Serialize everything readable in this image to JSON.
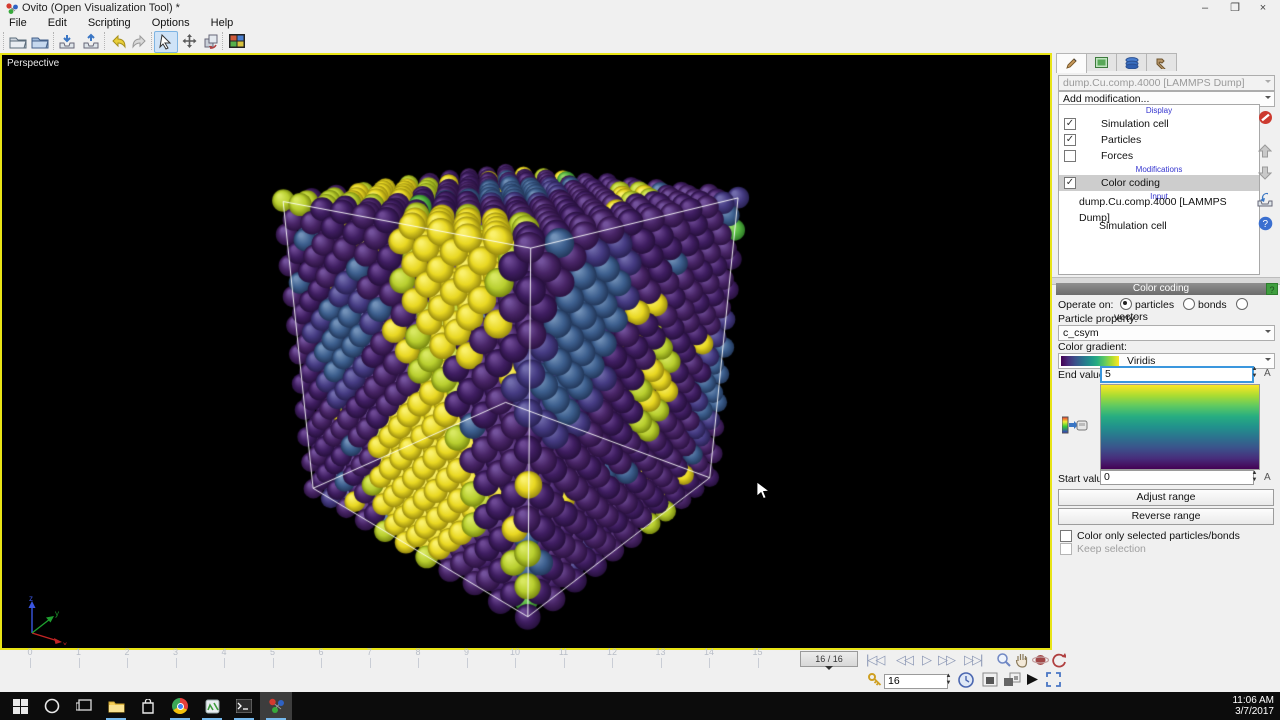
{
  "window": {
    "title": "Ovito (Open Visualization Tool) *",
    "minimize": "–",
    "restore": "❐",
    "close": "×"
  },
  "menubar": [
    "File",
    "Edit",
    "Scripting",
    "Options",
    "Help"
  ],
  "toolbar": [
    "open-file",
    "open-remote-file",
    "import-file",
    "export-file",
    "undo",
    "redo",
    "selection-mode",
    "move-mode",
    "rotate-mode",
    "render-settings"
  ],
  "viewport": {
    "label": "Perspective",
    "axis_x": "x",
    "axis_y": "y",
    "axis_z": "z"
  },
  "scene": {
    "cells": 10,
    "box_color": "rgba(255,255,255,0.9)",
    "palette": {
      "yellow": [
        "#faf06a",
        "#e9d822",
        "#97890e"
      ],
      "lime": [
        "#d8e860",
        "#b9cf2f",
        "#76860f"
      ],
      "green": [
        "#93d765",
        "#57b944",
        "#2e7a26"
      ],
      "purple": [
        "#6c4893",
        "#3f1e61",
        "#26103c"
      ],
      "purple2": [
        "#73529c",
        "#482566",
        "#2b1240"
      ],
      "slate": [
        "#716cac",
        "#453b82",
        "#282152"
      ],
      "blue": [
        "#7291b8",
        "#3d5f8e",
        "#22375a"
      ]
    }
  },
  "command_panel": {
    "tabs": [
      "modify",
      "render",
      "overlays",
      "utilities"
    ],
    "source_selector": "dump.Cu.comp.4000 [LAMMPS Dump]",
    "add_modification": "Add modification...",
    "pipeline": [
      {
        "type": "header",
        "label": "Display"
      },
      {
        "type": "item",
        "label": "Simulation cell",
        "checked": true
      },
      {
        "type": "item",
        "label": "Particles",
        "checked": true
      },
      {
        "type": "item",
        "label": "Forces",
        "checked": false
      },
      {
        "type": "header",
        "label": "Modifications"
      },
      {
        "type": "item",
        "label": "Color coding",
        "checked": true,
        "selected": true
      },
      {
        "type": "header",
        "label": "Input"
      },
      {
        "type": "input",
        "label": "dump.Cu.comp.4000 [LAMMPS Dump]"
      },
      {
        "type": "input2",
        "label": "Simulation cell"
      }
    ],
    "side_buttons": [
      "delete-modifier",
      "move-up",
      "move-down",
      "toggle-modifier",
      "help"
    ]
  },
  "color_coding": {
    "title": "Color coding",
    "help": "?",
    "operate_on_label": "Operate on:",
    "options": [
      {
        "label": "particles",
        "selected": true
      },
      {
        "label": "bonds",
        "selected": false
      },
      {
        "label": "vectors",
        "selected": false
      }
    ],
    "particle_property_label": "Particle property:",
    "particle_property": "c_csym",
    "gradient_label": "Color gradient:",
    "gradient_name": "Viridis",
    "end_value_label": "End value:",
    "end_value": "5",
    "start_value_label": "Start value:",
    "start_value": "0",
    "animatable": "A",
    "adjust_range": "Adjust range",
    "reverse_range": "Reverse range",
    "color_only_selected": "Color only selected particles/bonds",
    "keep_selection": "Keep selection",
    "gradient_stops": [
      "#fde725",
      "#aadc32",
      "#5ec962",
      "#27ad81",
      "#21918c",
      "#2c728e",
      "#3b528b",
      "#472d7b",
      "#440154"
    ]
  },
  "timeline": {
    "ticks": [
      "0",
      "1",
      "2",
      "3",
      "4",
      "5",
      "6",
      "7",
      "8",
      "9",
      "10",
      "11",
      "12",
      "13",
      "14",
      "15"
    ],
    "thumb": "16 / 16",
    "frame_value": "16"
  },
  "taskbar": {
    "apps": [
      "start",
      "cortana",
      "task-view",
      "file-explorer",
      "store",
      "chrome",
      "text-editor",
      "terminal",
      "ovito"
    ],
    "time": "11:06 AM",
    "date": "3/7/2017"
  }
}
